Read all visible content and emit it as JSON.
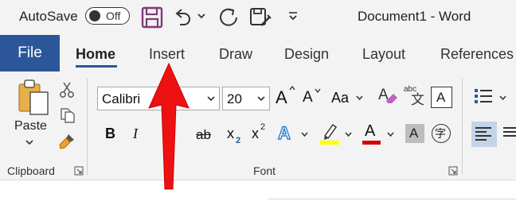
{
  "titlebar": {
    "autosave_label": "AutoSave",
    "autosave_state": "Off",
    "document_title": "Document1  -  Word"
  },
  "tabs": {
    "file": "File",
    "items": [
      "Home",
      "Insert",
      "Draw",
      "Design",
      "Layout",
      "References"
    ],
    "active": "Home"
  },
  "ribbon": {
    "clipboard": {
      "paste_label": "Paste",
      "group_label": "Clipboard"
    },
    "font": {
      "font_name": "Calibri",
      "font_size": "20",
      "group_label": "Font",
      "bold": "B",
      "italic": "I",
      "strikethrough": "ab",
      "subscript": "x",
      "subscript_index": "2",
      "superscript": "x",
      "superscript_index": "2",
      "grow_font": "A",
      "shrink_font": "A",
      "change_case": "Aa",
      "text_effects": "A",
      "font_color": "A",
      "shading": "A",
      "border_char": "A",
      "phonetic_guide": "abc",
      "enclose_char": "字"
    }
  },
  "colors": {
    "accent": "#2b579a",
    "ribbon_bg": "#f3f3f3",
    "save_icon": "#80397b",
    "highlight": "#ffff00",
    "font_color_bar": "#d00000",
    "annotation_arrow": "#ee1111"
  },
  "icons": [
    "toggle-switch",
    "save-icon",
    "undo-icon",
    "redo-icon",
    "touch-mode-icon",
    "customize-toolbar-icon",
    "paste-icon",
    "cut-icon",
    "copy-icon",
    "format-painter-icon",
    "clear-formatting-icon",
    "bullets-icon",
    "align-left-icon"
  ]
}
